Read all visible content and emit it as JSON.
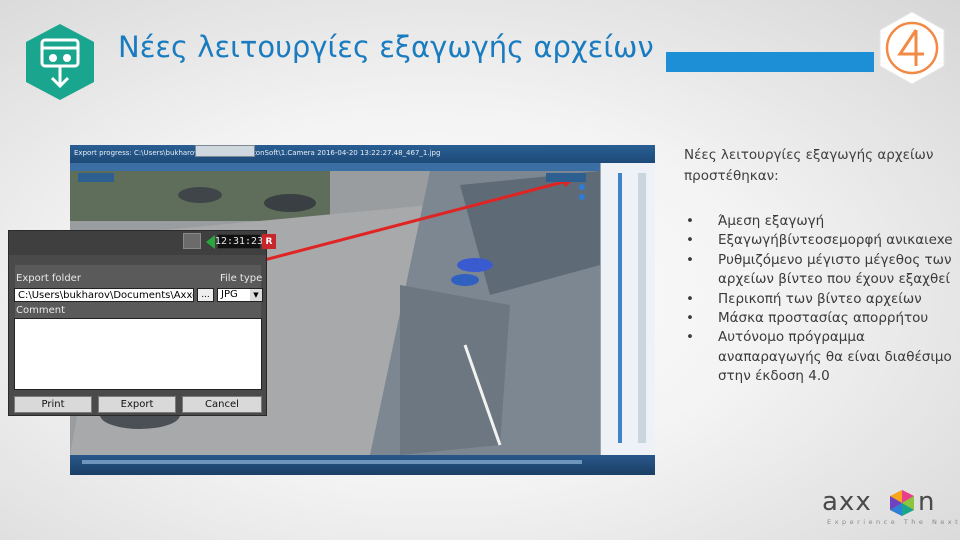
{
  "slide": {
    "title": "Νέες λειτουργίες εξαγωγής αρχείων"
  },
  "screenshot": {
    "path_text": "Export progress: C:\\Users\\bukharov\\Documents\\AxxonSoft\\1.Camera 2016-04-20 13:22:27.48_467_1.jpg",
    "dialog": {
      "time": "12:31:23",
      "rec_button": "R",
      "export_folder_label": "Export folder",
      "file_type_label": "File type",
      "folder_value": "C:\\Users\\bukharov\\Documents\\AxxonS",
      "browse_label": "...",
      "file_type_value": "JPG",
      "comment_label": "Comment",
      "buttons": {
        "print": "Print",
        "export": "Export",
        "cancel": "Cancel"
      }
    }
  },
  "content": {
    "intro_line1": "Νέες λειτουργίες εξαγωγής αρχείων",
    "intro_line2": "προστέθηκαν:",
    "bullets": [
      "Άμεση εξαγωγή",
      "Εξαγωγήβίντεοσεμορφή ανικαιexe",
      "Ρυθμιζόμενο μέγιστο μέγεθος των αρχείων βίντεο που έχουν εξαχθεί",
      "Περικοπή των βίντεο αρχείων",
      "Μάσκα προστασίας απορρήτου",
      "Αυτόνομο πρόγραμμα αναπαραγωγής θα είναι διαθέσιμο στην έκδοση 4.0"
    ]
  },
  "footer": {
    "brand": "axxon",
    "tagline": "Experience The Next®"
  },
  "colors": {
    "title_blue": "#1a7cc0",
    "accent_bar": "#1d8fd6",
    "icon_teal": "#1aa58f",
    "logo_orange": "#f28a45"
  }
}
